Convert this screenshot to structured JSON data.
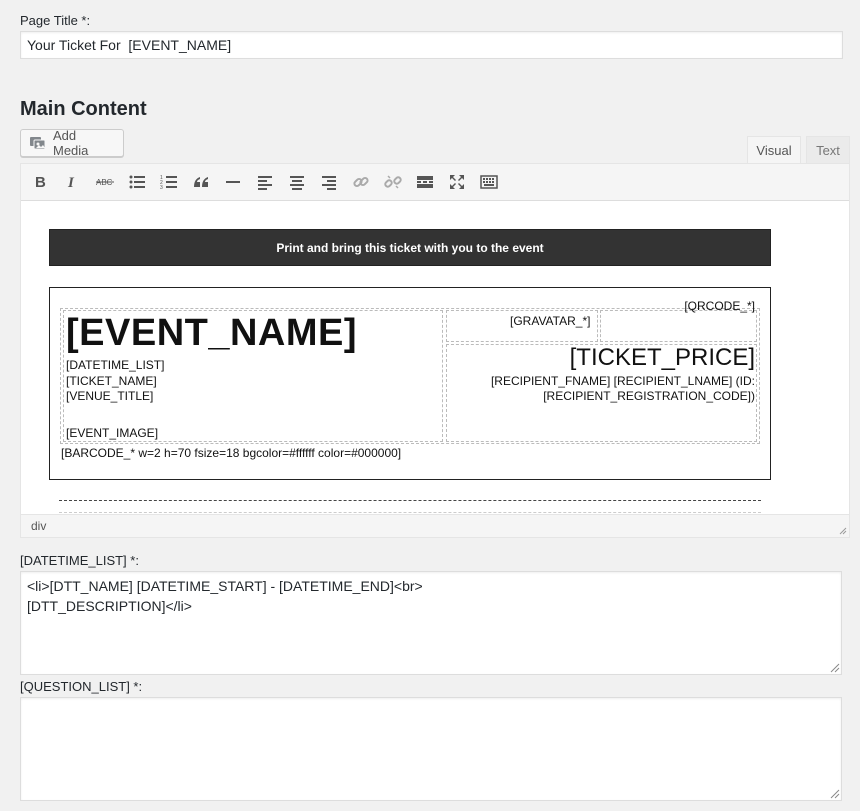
{
  "page_title": {
    "label": "Page Title *:",
    "value": "Your Ticket For  [EVENT_NAME]"
  },
  "main_content": {
    "heading": "Main Content",
    "add_media_label": "Add Media",
    "tabs": [
      {
        "label": "Visual",
        "active": true
      },
      {
        "label": "Text",
        "active": false
      }
    ],
    "toolbar_icons": [
      "bold-icon",
      "italic-icon",
      "strikethrough-icon",
      "bullet-list-icon",
      "numbered-list-icon",
      "blockquote-icon",
      "horizontal-rule-icon",
      "align-left-icon",
      "align-center-icon",
      "align-right-icon",
      "link-icon",
      "unlink-icon",
      "read-more-icon",
      "fullscreen-icon",
      "toolbar-toggle-icon"
    ],
    "strikethrough_glyph": "ABC",
    "status_path": "div"
  },
  "ticket": {
    "banner": "Print and bring this ticket with you to the event",
    "qrcode": "[QRCODE_*]",
    "event_name": "[EVENT_NAME]",
    "datetime_list": "[DATETIME_LIST]",
    "ticket_name": "[TICKET_NAME]",
    "venue_title": "[VENUE_TITLE]",
    "event_image": "[EVENT_IMAGE]",
    "gravatar": "[GRAVATAR_*]",
    "ticket_price": "[TICKET_PRICE]",
    "recipient_line1": "[RECIPIENT_FNAME] [RECIPIENT_LNAME] (ID:",
    "recipient_line2": "[RECIPIENT_REGISTRATION_CODE])",
    "barcode": "[BARCODE_* w=2 h=70 fsize=18 bgcolor=#ffffff color=#000000]"
  },
  "datetime_field": {
    "label": "[DATETIME_LIST] *:",
    "value": "<li>[DTT_NAME] [DATETIME_START] - [DATETIME_END]<br>\n[DTT_DESCRIPTION]</li>"
  },
  "question_field": {
    "label": "[QUESTION_LIST] *:",
    "value": ""
  },
  "colors": {
    "background": "#f1f1f1",
    "banner": "#333333",
    "toolbar": "#f5f5f5"
  }
}
